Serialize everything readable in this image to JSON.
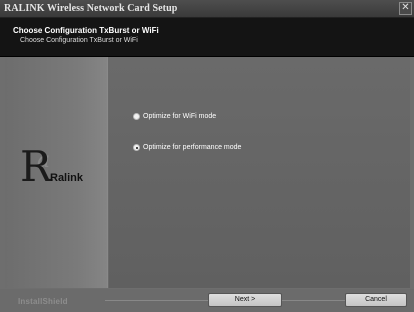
{
  "window": {
    "title": "RALINK Wireless Network Card Setup",
    "close_glyph": "✕"
  },
  "header": {
    "title": "Choose Configuration TxBurst or WiFi",
    "subtitle": "Choose Configuration TxBurst or WiFi"
  },
  "logo": {
    "letter": "R",
    "letter_small": "a",
    "text": "Ralink"
  },
  "options": [
    {
      "label": "Optimize for WiFi mode",
      "selected": false
    },
    {
      "label": "Optimize for performance mode",
      "selected": true
    }
  ],
  "footer": {
    "brand": "InstallShield",
    "next_label": "Next >",
    "cancel_label": "Cancel"
  },
  "colors": {
    "header_bg": "#141414",
    "content_bg": "#666666",
    "title_text": "#e6e6e6"
  },
  "icons": [
    "close-icon",
    "radio-icon"
  ]
}
